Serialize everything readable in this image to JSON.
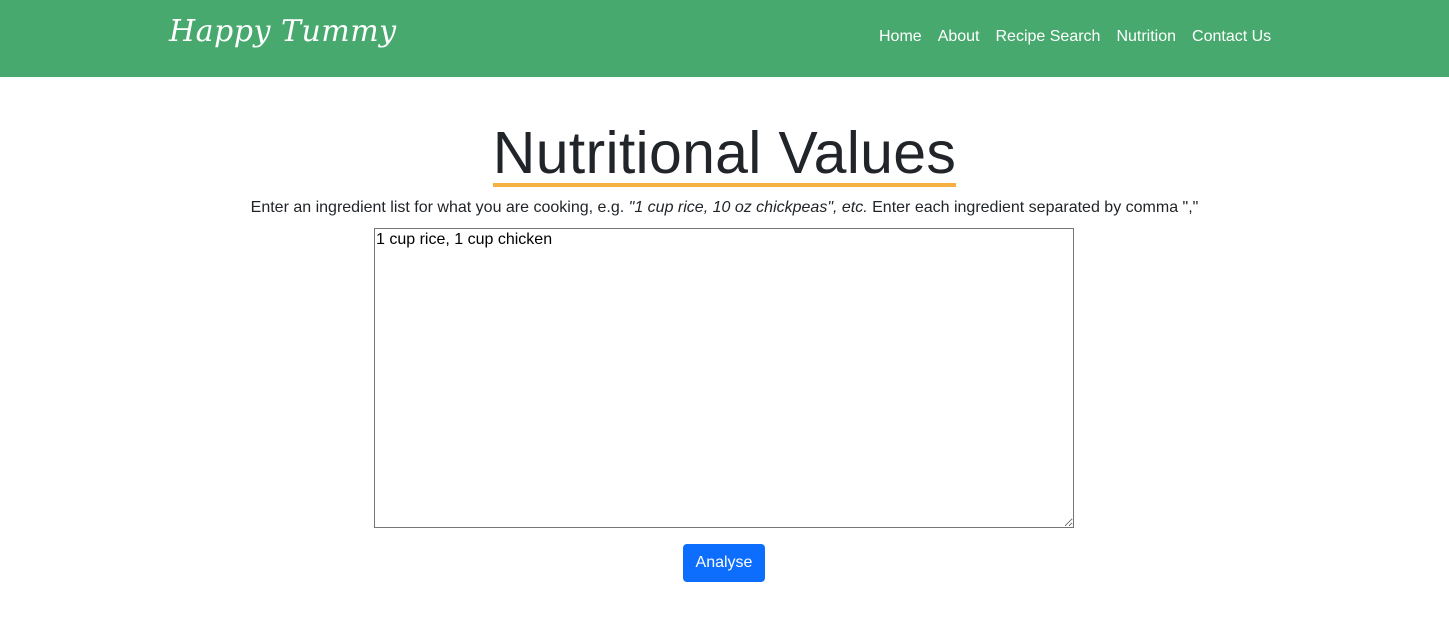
{
  "nav": {
    "brand": "Happy Tummy",
    "links": [
      "Home",
      "About",
      "Recipe Search",
      "Nutrition",
      "Contact Us"
    ]
  },
  "main": {
    "title": "Nutritional Values",
    "instructions": {
      "prefix": "Enter an ingredient list for what you are cooking, e.g. ",
      "example": "\"1 cup rice, 10 oz chickpeas\", etc.",
      "suffix": " Enter each ingredient separated by comma \",\""
    },
    "ingredients_value": "1 cup rice, 1 cup chicken",
    "analyse_label": "Analyse"
  },
  "colors": {
    "navbar": "#48a96e",
    "title_underline": "#f5b041",
    "button": "#0d6efd"
  }
}
